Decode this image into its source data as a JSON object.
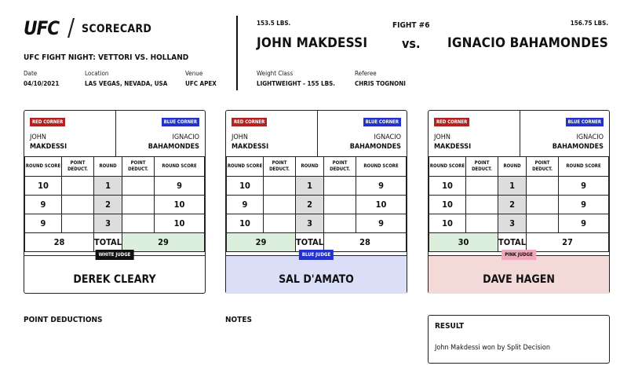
{
  "header": {
    "logo_text": "UFC",
    "slash": "/",
    "scorecard_label": "SCORECARD",
    "event_title": "UFC FIGHT NIGHT: VETTORI VS. HOLLAND",
    "date_label": "Date",
    "date_value": "04/10/2021",
    "location_label": "Location",
    "location_value": "LAS VEGAS, NEVADA, USA",
    "venue_label": "Venue",
    "venue_value": "UFC APEX"
  },
  "fight": {
    "red_weight": "153.5 LBS.",
    "fight_number": "FIGHT #6",
    "blue_weight": "156.75 LBS.",
    "red_name": "JOHN MAKDESSI",
    "vs": "vs.",
    "blue_name": "IGNACIO BAHAMONDES",
    "weight_class_label": "Weight Class",
    "weight_class_value": "LIGHTWEIGHT - 155 LBS.",
    "referee_label": "Referee",
    "referee_value": "CHRIS TOGNONI"
  },
  "table_headers": {
    "round_score": "ROUND SCORE",
    "point_deduct": "POINT DEDUCT.",
    "round": "ROUND",
    "total": "TOTAL"
  },
  "cards": [
    {
      "red_corner": "RED CORNER",
      "blue_corner": "BLUE CORNER",
      "red_first": "JOHN",
      "red_last": "MAKDESSI",
      "blue_first": "IGNACIO",
      "blue_last": "BAHAMONDES",
      "rounds": [
        {
          "red": "10",
          "red_ded": "",
          "round": "1",
          "blue_ded": "",
          "blue": "9"
        },
        {
          "red": "9",
          "red_ded": "",
          "round": "2",
          "blue_ded": "",
          "blue": "10"
        },
        {
          "red": "9",
          "red_ded": "",
          "round": "3",
          "blue_ded": "",
          "blue": "10"
        }
      ],
      "red_total": "28",
      "blue_total": "29",
      "judge_badge": "WHITE JUDGE",
      "judge_name": "DEREK CLEARY"
    },
    {
      "red_corner": "RED CORNER",
      "blue_corner": "BLUE CORNER",
      "red_first": "JOHN",
      "red_last": "MAKDESSI",
      "blue_first": "IGNACIO",
      "blue_last": "BAHAMONDES",
      "rounds": [
        {
          "red": "10",
          "red_ded": "",
          "round": "1",
          "blue_ded": "",
          "blue": "9"
        },
        {
          "red": "9",
          "red_ded": "",
          "round": "2",
          "blue_ded": "",
          "blue": "10"
        },
        {
          "red": "10",
          "red_ded": "",
          "round": "3",
          "blue_ded": "",
          "blue": "9"
        }
      ],
      "red_total": "29",
      "blue_total": "28",
      "judge_badge": "BLUE JUDGE",
      "judge_name": "SAL D'AMATO"
    },
    {
      "red_corner": "RED CORNER",
      "blue_corner": "BLUE CORNER",
      "red_first": "JOHN",
      "red_last": "MAKDESSI",
      "blue_first": "IGNACIO",
      "blue_last": "BAHAMONDES",
      "rounds": [
        {
          "red": "10",
          "red_ded": "",
          "round": "1",
          "blue_ded": "",
          "blue": "9"
        },
        {
          "red": "10",
          "red_ded": "",
          "round": "2",
          "blue_ded": "",
          "blue": "9"
        },
        {
          "red": "10",
          "red_ded": "",
          "round": "3",
          "blue_ded": "",
          "blue": "9"
        }
      ],
      "red_total": "30",
      "blue_total": "27",
      "judge_badge": "PINK JUDGE",
      "judge_name": "DAVE HAGEN"
    }
  ],
  "footer": {
    "point_deductions_label": "POINT DEDUCTIONS",
    "notes_label": "NOTES",
    "result_label": "RESULT",
    "result_text": "John Makdessi won by Split Decision"
  },
  "colors": {
    "red_badge": "#b22222",
    "blue_badge": "#2333c8",
    "winner_fill": "#dbefdc",
    "blue_judge_fill": "#dadff7",
    "pink_judge_fill": "#f4d9d9"
  }
}
